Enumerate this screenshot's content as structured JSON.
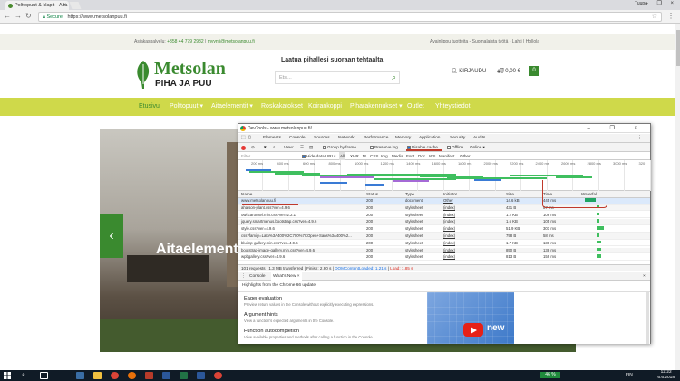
{
  "browser": {
    "tab_title": "Polttopuut & klapit - Aita",
    "tab_close": "×",
    "user": "Tuupa",
    "window_buttons": "– ❐ ×",
    "secure_label": "Secure",
    "url": "https://www.metsolanpuu.fi"
  },
  "site": {
    "contact_label": "Asiakaspalvelu:",
    "contact_phone": "+358 44 779 2982",
    "contact_sep": "|",
    "contact_email": "myynti@metsolanpuu.fi",
    "top_right": "Avainlippu tuotteita - Suomalaista työtä - Lahti | Hollola",
    "brand_main": "Metsolan",
    "brand_sub": "PIHA JA PUU",
    "tagline": "Laatua pihallesi suoraan tehtaalta",
    "search_placeholder": "Etsi...",
    "login": "KIRJAUDU",
    "cart_total": "0,00 €",
    "cart_count": "0",
    "nav": [
      {
        "label": "Etusivu"
      },
      {
        "label": "Polttopuut ▾"
      },
      {
        "label": "Aitaelementit ▾"
      },
      {
        "label": "Roskakatokset"
      },
      {
        "label": "Koirankoppi"
      },
      {
        "label": "Piharakennukset ▾"
      },
      {
        "label": "Outlet"
      },
      {
        "label": "Yhteystiedot"
      }
    ],
    "hero_title": "Aitaelement",
    "hero_prev": "‹"
  },
  "devtools": {
    "title": "DevTools - www.metsolanpuu.fi/",
    "tabs": [
      "Elements",
      "Console",
      "Sources",
      "Network",
      "Performance",
      "Memory",
      "Application",
      "Security",
      "Audits"
    ],
    "toolbar": {
      "view": "View:",
      "group": "Group by frame",
      "preserve": "Preserve log",
      "disable_cache": "Disable cache",
      "offline": "Offline",
      "online": "Online ▾"
    },
    "filter": {
      "placeholder": "Filter",
      "hide_data": "Hide data URLs",
      "types": [
        "All",
        "XHR",
        "JS",
        "CSS",
        "Img",
        "Media",
        "Font",
        "Doc",
        "WS",
        "Manifest",
        "Other"
      ]
    },
    "overview_ticks": [
      "200 ms",
      "400 ms",
      "600 ms",
      "800 ms",
      "1000 ms",
      "1200 ms",
      "1400 ms",
      "1600 ms",
      "1800 ms",
      "2000 ms",
      "2200 ms",
      "2400 ms",
      "2600 ms",
      "2800 ms",
      "3000 ms",
      "320"
    ],
    "columns": [
      "Name",
      "Status",
      "Type",
      "Initiator",
      "Size",
      "Time",
      "Waterfall"
    ],
    "rows": [
      {
        "name": "www.metsolanpuu.fi",
        "status": "200",
        "type": "document",
        "initiator": "Other",
        "size": "14.6 kB",
        "time": "445 ms"
      },
      {
        "name": "ahalson-plant.css?ver=4.9.6",
        "status": "200",
        "type": "stylesheet",
        "initiator": "(index)",
        "size": "431 B",
        "time": "87 ms"
      },
      {
        "name": "owl.carousel.min.css?ver=2.2.1",
        "status": "200",
        "type": "stylesheet",
        "initiator": "(index)",
        "size": "1.2 KB",
        "time": "106 ms"
      },
      {
        "name": "jquery.smartmenus.bootstrap.css?ver=4.9.6",
        "status": "200",
        "type": "stylesheet",
        "initiator": "(index)",
        "size": "1.6 KB",
        "time": "105 ms"
      },
      {
        "name": "style.css?ver=4.9.6",
        "status": "200",
        "type": "stylesheet",
        "initiator": "(index)",
        "size": "51.9 KB",
        "time": "301 ms"
      },
      {
        "name": "css?family=Lato%3A400%2C700%7COpen+Sans%3A400%2...",
        "status": "200",
        "type": "stylesheet",
        "initiator": "(index)",
        "size": "798 B",
        "time": "58 ms"
      },
      {
        "name": "bluimp-gallery.min.css?ver=4.9.6",
        "status": "200",
        "type": "stylesheet",
        "initiator": "(index)",
        "size": "1.7 KB",
        "time": "138 ms"
      },
      {
        "name": "bootstrap-image-gallery.min.css?ver=4.9.6",
        "status": "200",
        "type": "stylesheet",
        "initiator": "(index)",
        "size": "850 B",
        "time": "138 ms"
      },
      {
        "name": "wpbgallery.css?ver=4.9.6",
        "status": "200",
        "type": "stylesheet",
        "initiator": "(index)",
        "size": "813 B",
        "time": "159 ms"
      }
    ],
    "status": {
      "requests": "101 requests",
      "transferred": "1.3 MB transferred",
      "finish": "Finish: 2.90 s",
      "dcl": "DOMContentLoaded: 1.21 s",
      "load": "Load: 1.85 s"
    },
    "drawer": {
      "tabs": [
        "Console",
        "What's New ×"
      ],
      "highlights": "Highlights from the Chrome 66 update",
      "close": "×",
      "features": [
        {
          "title": "Eager evaluation",
          "desc": "Preview return values in the Console without explicitly executing expressions."
        },
        {
          "title": "Argument hints",
          "desc": "View a function's expected arguments in the Console."
        },
        {
          "title": "Function autocompletion",
          "desc": "View available properties and methods after calling a function in the Console."
        }
      ],
      "video_label": "new"
    }
  },
  "taskbar": {
    "battery": "46 %",
    "lang": "FIN",
    "time": "12:22",
    "date": "6.6.2018"
  },
  "colors": {
    "brand_green": "#3a8a2f",
    "nav_bar": "#cfd94a",
    "annotation_red": "#c0392b"
  }
}
